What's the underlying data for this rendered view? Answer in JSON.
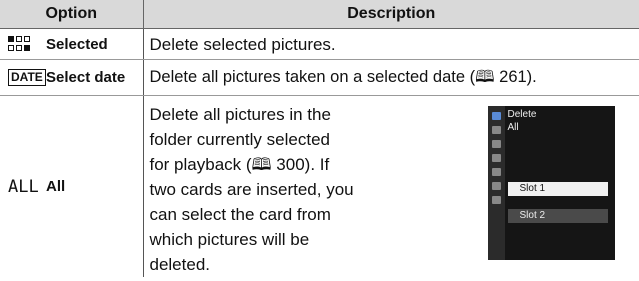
{
  "table": {
    "headers": {
      "option": "Option",
      "description": "Description"
    },
    "rows": [
      {
        "icon": "selected-thumbnails-icon",
        "label": "Selected",
        "description": "Delete selected pictures."
      },
      {
        "icon": "date-icon",
        "icon_text": "DATE",
        "label": "Select date",
        "description": "Delete all pictures taken on a selected date (🕮 261)."
      },
      {
        "icon": "all-icon",
        "icon_text": "ALL",
        "label": "All",
        "description_lines": [
          "Delete all pictures in the",
          "folder currently selected",
          "for playback (🕮 300).  If",
          "two cards are inserted, you",
          "can select the card from",
          "which pictures will be",
          "deleted."
        ]
      }
    ]
  },
  "camera_screen": {
    "title": "Delete",
    "subtitle": "All",
    "slot1": "Slot 1",
    "slot2": "Slot 2"
  }
}
